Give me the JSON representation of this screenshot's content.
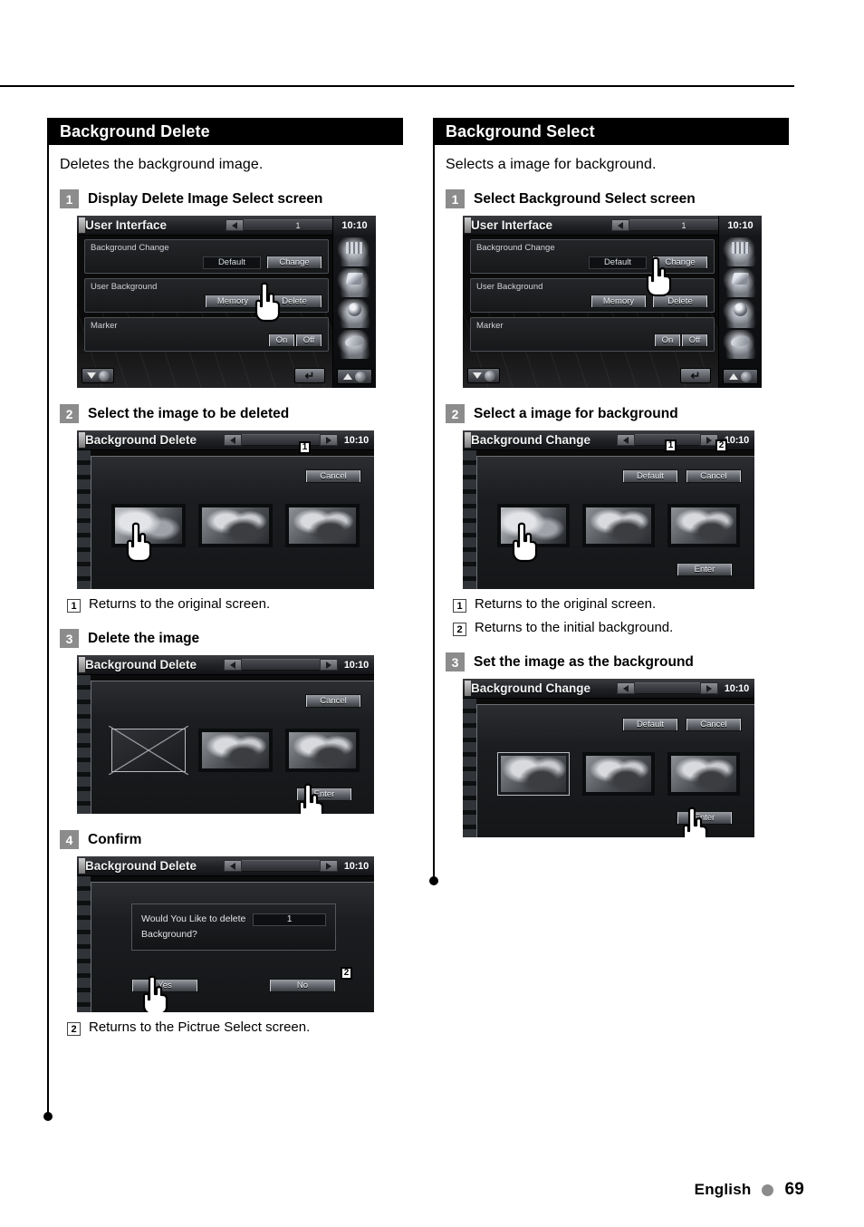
{
  "page": {
    "footer_language": "English",
    "page_number": "69"
  },
  "left_column": {
    "section_title": "Background Delete",
    "section_desc": "Deletes the background image.",
    "steps": [
      {
        "num": "1",
        "title": "Display Delete Image Select screen"
      },
      {
        "num": "2",
        "title": "Select the image to be deleted"
      },
      {
        "num": "3",
        "title": "Delete the image"
      },
      {
        "num": "4",
        "title": "Confirm"
      }
    ],
    "notes": [
      {
        "num": "1",
        "text": "Returns to the original screen."
      },
      {
        "num": "2",
        "text": "Returns to the Pictrue Select screen."
      }
    ],
    "screen1": {
      "title": "User Interface",
      "page_value": "1",
      "clock": "10:10",
      "rows": [
        {
          "label": "Background Change",
          "value": "Default",
          "button": "Change"
        },
        {
          "label": "User Background",
          "button1": "Memory",
          "button2": "Delete"
        },
        {
          "label": "Marker",
          "on": "On",
          "off": "Off"
        }
      ]
    },
    "screen2": {
      "title": "Background Delete",
      "clock": "10:10",
      "cancel": "Cancel",
      "badge_cancel": "1"
    },
    "screen3": {
      "title": "Background Delete",
      "clock": "10:10",
      "cancel": "Cancel",
      "enter": "Enter"
    },
    "screen4": {
      "title": "Background Delete",
      "clock": "10:10",
      "message_line1": "Would You Like to delete",
      "message_line2": "Background?",
      "count": "1",
      "yes": "Yes",
      "no": "No",
      "badge_no": "2"
    }
  },
  "right_column": {
    "section_title": "Background Select",
    "section_desc": "Selects a image for background.",
    "steps": [
      {
        "num": "1",
        "title": "Select Background Select screen"
      },
      {
        "num": "2",
        "title": "Select a image for background"
      },
      {
        "num": "3",
        "title": "Set the image as the background"
      }
    ],
    "notes": [
      {
        "num": "1",
        "text": "Returns to the original screen."
      },
      {
        "num": "2",
        "text": "Returns to the initial background."
      }
    ],
    "screen1": {
      "title": "User Interface",
      "page_value": "1",
      "clock": "10:10",
      "rows": [
        {
          "label": "Background Change",
          "value": "Default",
          "button": "Change"
        },
        {
          "label": "User Background",
          "button1": "Memory",
          "button2": "Delete"
        },
        {
          "label": "Marker",
          "on": "On",
          "off": "Off"
        }
      ]
    },
    "screen2": {
      "title": "Background Change",
      "clock": "10:10",
      "default": "Default",
      "cancel": "Cancel",
      "enter": "Enter",
      "badge_default": "1",
      "badge_cancel": "2"
    },
    "screen3": {
      "title": "Background Change",
      "clock": "10:10",
      "default": "Default",
      "cancel": "Cancel",
      "enter": "Enter"
    }
  }
}
